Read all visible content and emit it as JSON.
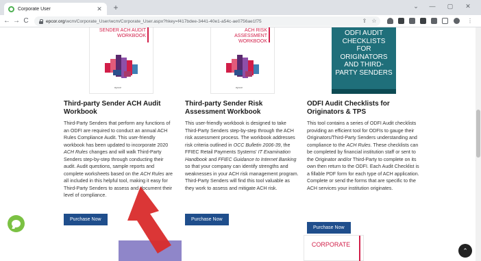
{
  "browser": {
    "tab_title": "Corporate User",
    "tab_close": "✕",
    "new_tab": "+",
    "url_host": "epcor.org",
    "url_path": "/wcm/Corporate_User/wcm/Corporate_User.aspx?hkey=f417bdee-3441-40e1-a54c-ae0756ae1f75",
    "back": "←",
    "forward": "→",
    "reload": "C",
    "minimize": "—",
    "maximize": "▢",
    "close": "✕",
    "chevron": "⌄"
  },
  "colors": {
    "accent_red": "#d11e48",
    "teal_cover": "#1f6f7a",
    "button_blue": "#1f4e8c",
    "chat_green": "#7bc143",
    "arrow_red": "#d92b2b"
  },
  "products": [
    {
      "cover_title": "Sender ACH Audit Workbook",
      "cover_logo": "epcor",
      "title": "Third-party Sender ACH Audit Workbook",
      "description": [
        {
          "t": "Third-Party Senders that perform any functions of an ODFI are required to conduct an annual ACH Rules Compliance Audit. This user-friendly workbook has been updated to incorporate 2020 "
        },
        {
          "t": "ACH Rules",
          "i": true
        },
        {
          "t": " changes and will walk Third-Party Senders step-by-step through conducting their audit. Audit questions, sample reports and complete worksheets based on the "
        },
        {
          "t": "ACH Rules",
          "i": true
        },
        {
          "t": " are all included in this helpful tool, making it easy for Third-Party Senders to assess and document their level of compliance."
        }
      ],
      "button": "Purchase Now"
    },
    {
      "cover_title": "ACH Risk Assessment Workbook",
      "cover_logo": "epcor",
      "title": "Third-party Sender Risk Assessment Workbook",
      "description": [
        {
          "t": "This user-friendly workbook is designed to take Third-Party Senders step-by-step through the ACH risk assessment process. The workbook addresses risk criteria outlined in "
        },
        {
          "t": "OCC Bulletin 2006-39",
          "i": true
        },
        {
          "t": ", the FFIEC Retail Payments Systems' "
        },
        {
          "t": "IT Examination Handbook",
          "i": true
        },
        {
          "t": " and "
        },
        {
          "t": "FFIEC Guidance to Internet Banking",
          "i": true
        },
        {
          "t": " so that your company can identify strengths and weaknesses in your ACH risk management program. Third-Party Senders will find this tool valuable as they work to assess and mitigate ACH risk."
        }
      ],
      "button": "Purchase Now"
    },
    {
      "cover_title": "ODFI Audit Checklists for Originators and Third-Party Senders",
      "title": "ODFI Audit Checklists for Originators & TPS",
      "description": [
        {
          "t": "This tool contains a series of ODFI Audit checklists providing an efficient tool for ODFIs to gauge their Originators/Third-Party Senders understanding and compliance to the "
        },
        {
          "t": "ACH Rules",
          "i": true
        },
        {
          "t": ". These checklists can be completed by financial institution staff or sent to the Originator and/or Third-Party to complete on its own then return to the ODFI. Each Audit Checklist is a fillable PDF form for each type of ACH application. Complete or send the forms that are specific to the ACH services your institution originates."
        }
      ],
      "button": "Purchase Now"
    }
  ],
  "next_row": {
    "cover3_title": "Corporate"
  },
  "scroll_top": "⌃"
}
